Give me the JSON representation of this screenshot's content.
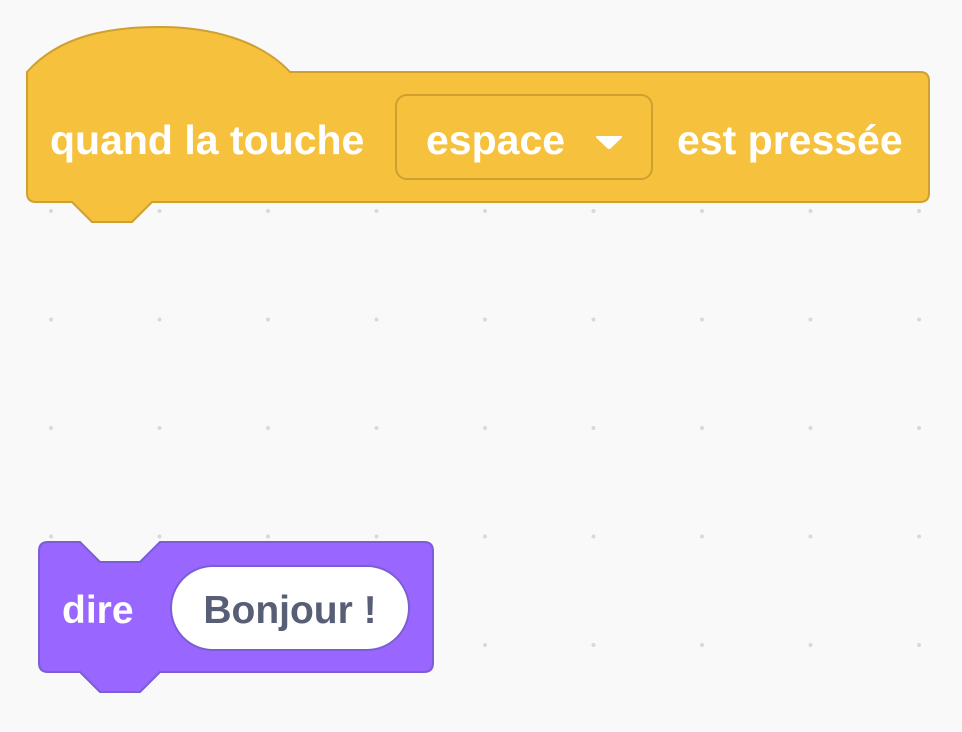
{
  "workspace": {
    "background": "#f9f9f9",
    "grid_dot_color": "#d9d9d9"
  },
  "hat_block": {
    "category": "events",
    "color": "#f6c23e",
    "border_color": "#cfa02f",
    "label_before": "quand la touche",
    "key_value": "espace",
    "dropdown_icon": "triangle-down-icon",
    "label_after": "est pressée"
  },
  "say_block": {
    "category": "looks",
    "color": "#9966ff",
    "border_color": "#7b5ed6",
    "label": "dire",
    "message": "Bonjour !",
    "message_text_color": "#575e75"
  }
}
